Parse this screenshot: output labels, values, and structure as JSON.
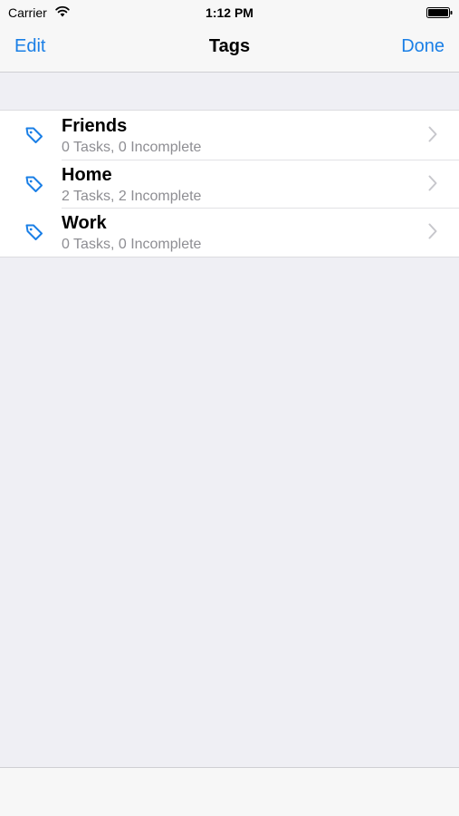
{
  "status_bar": {
    "carrier": "Carrier",
    "time": "1:12 PM"
  },
  "nav": {
    "left_label": "Edit",
    "title": "Tags",
    "right_label": "Done"
  },
  "tags": [
    {
      "name": "Friends",
      "summary": "0 Tasks, 0 Incomplete",
      "icon": "tag-icon"
    },
    {
      "name": "Home",
      "summary": "2 Tasks, 2 Incomplete",
      "icon": "tag-icon"
    },
    {
      "name": "Work",
      "summary": "0 Tasks, 0 Incomplete",
      "icon": "tag-icon"
    }
  ],
  "colors": {
    "accent": "#1a7fe6",
    "background": "#efeff4",
    "secondary_text": "#8e8e93"
  }
}
